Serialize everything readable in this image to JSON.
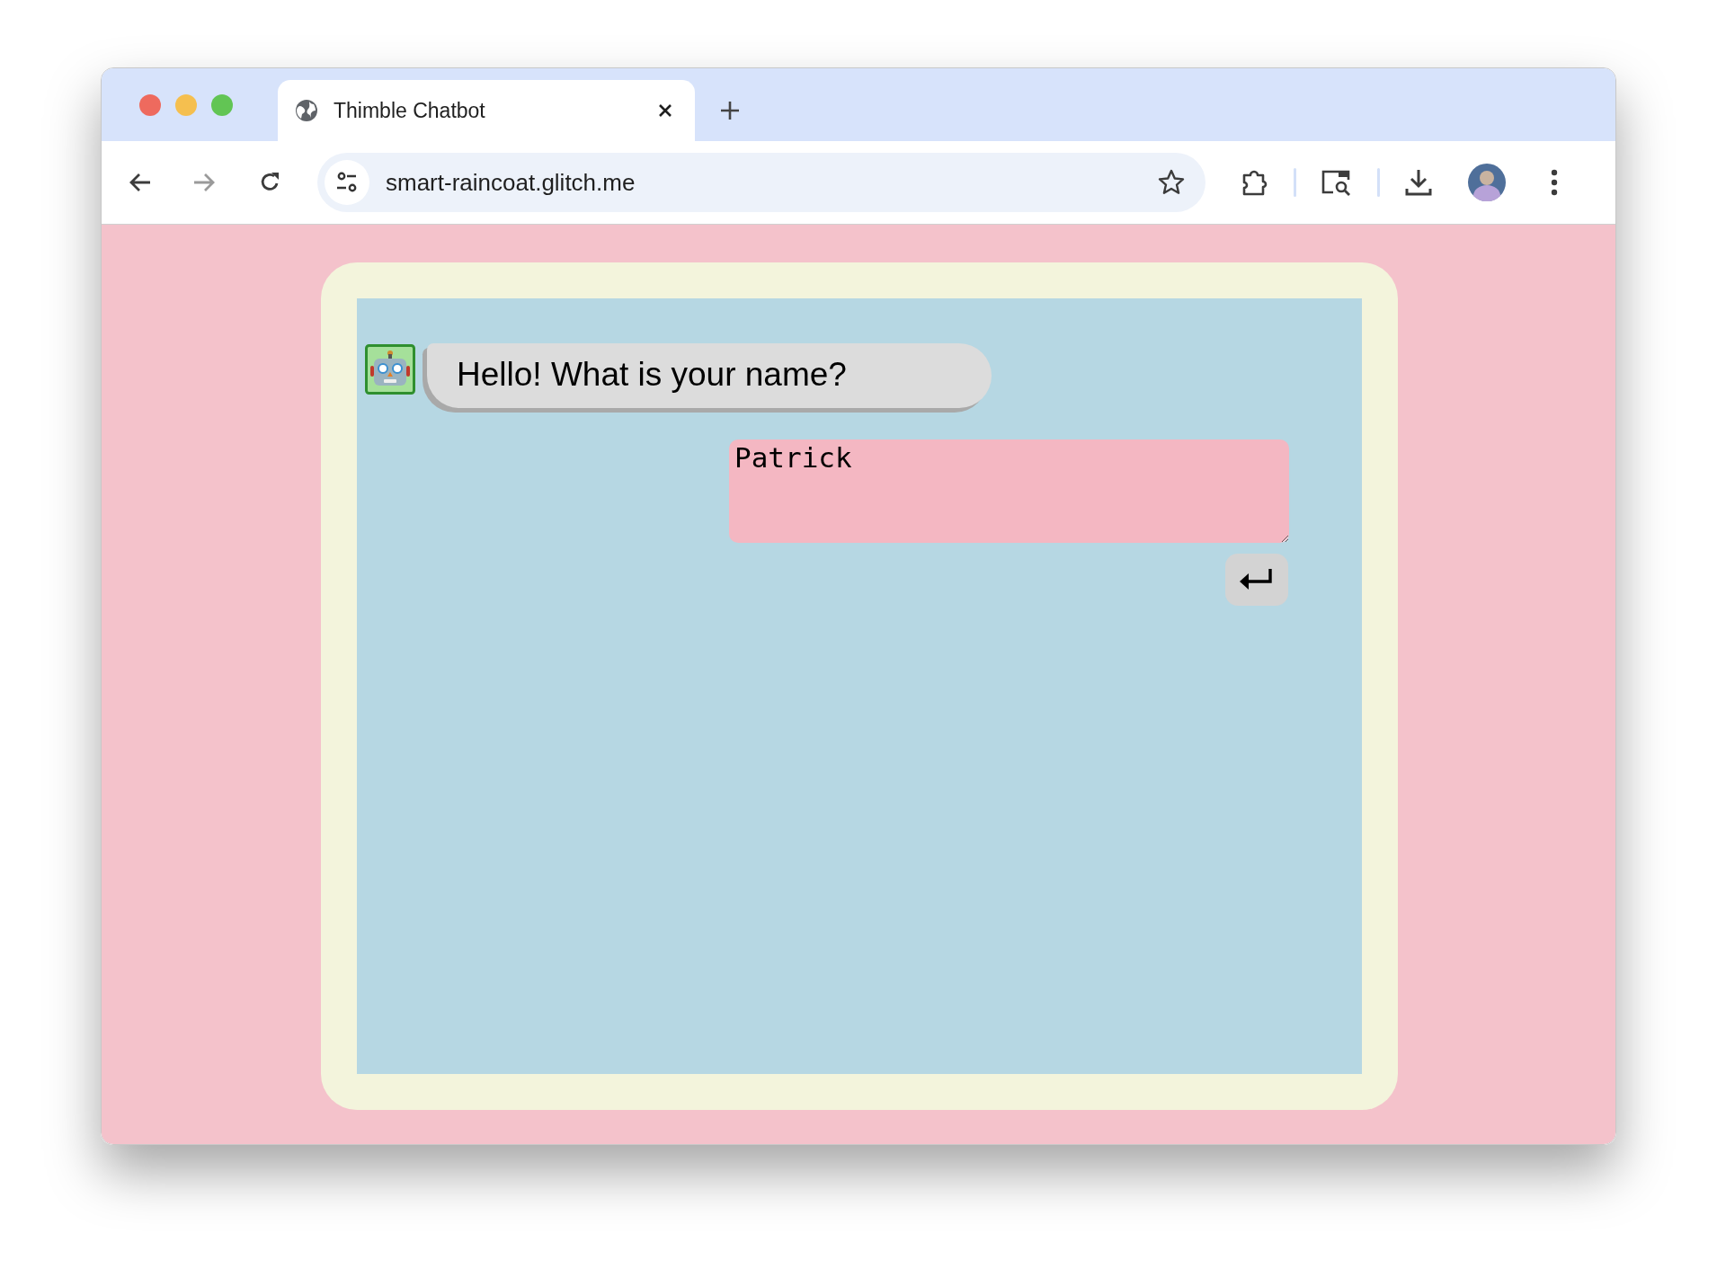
{
  "browser": {
    "tab": {
      "title": "Thimble Chatbot"
    },
    "address_bar": {
      "url": "smart-raincoat.glitch.me"
    }
  },
  "chat": {
    "messages": [
      {
        "kind": "bot",
        "text": "Hello! What is your name?"
      }
    ],
    "reply_field": {
      "value": "Patrick"
    }
  }
}
